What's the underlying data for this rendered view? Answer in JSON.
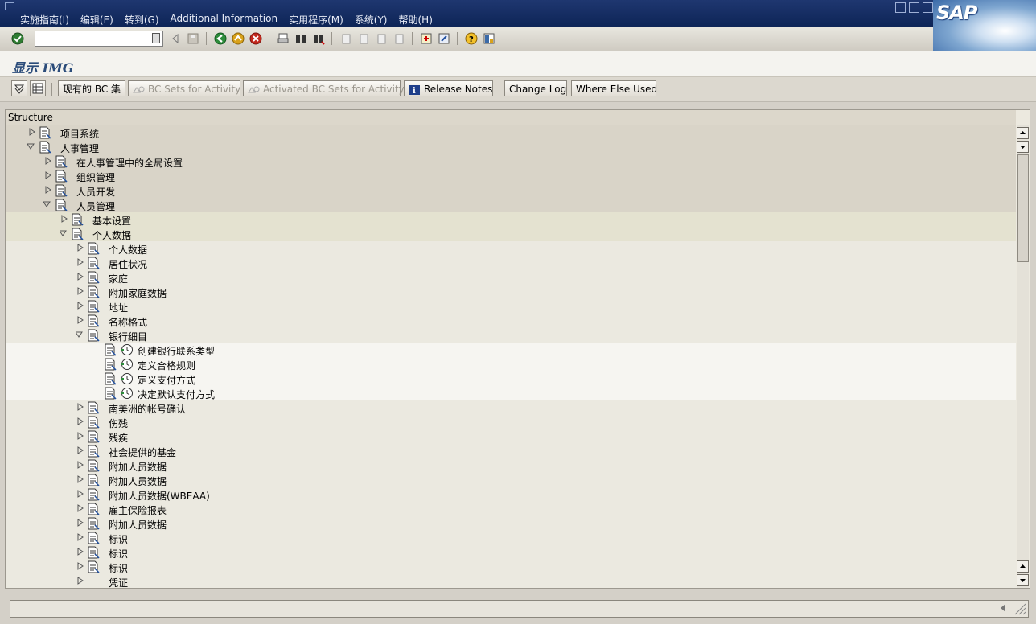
{
  "menubar": {
    "items": [
      "实施指南(I)",
      "编辑(E)",
      "转到(G)",
      "Additional Information",
      "实用程序(M)",
      "系统(Y)",
      "帮助(H)"
    ]
  },
  "logo": {
    "text": "SAP"
  },
  "toolbar": {
    "icons": [
      "enter-icon",
      "back-icon",
      "exit-icon",
      "cancel-icon",
      "print-icon",
      "find-icon",
      "find-next-icon",
      "first-page-icon",
      "prev-page-icon",
      "next-page-icon",
      "last-page-icon",
      "create-session-icon",
      "shortcut-icon",
      "help-icon",
      "layout-icon"
    ]
  },
  "title": {
    "text": "显示 IMG"
  },
  "appbar": {
    "existing_bc": "现有的 BC 集",
    "bc_sets_activity": "BC Sets for Activity",
    "activated_bc_sets": "Activated BC Sets for Activity",
    "release_notes": "Release Notes",
    "change_log": "Change Log",
    "where_else_used": "Where Else Used"
  },
  "tree": {
    "header": "Structure",
    "rows": [
      {
        "label": "项目系统",
        "level": 0,
        "expanded": false,
        "doc": true
      },
      {
        "label": "人事管理",
        "level": 0,
        "expanded": true,
        "doc": true
      },
      {
        "label": "在人事管理中的全局设置",
        "level": 1,
        "expanded": false,
        "doc": true
      },
      {
        "label": "组织管理",
        "level": 1,
        "expanded": false,
        "doc": true
      },
      {
        "label": "人员开发",
        "level": 1,
        "expanded": false,
        "doc": true
      },
      {
        "label": "人员管理",
        "level": 1,
        "expanded": true,
        "doc": true
      },
      {
        "label": "基本设置",
        "level": 2,
        "expanded": false,
        "doc": true
      },
      {
        "label": "个人数据",
        "level": 2,
        "expanded": true,
        "doc": true
      },
      {
        "label": "个人数据",
        "level": 3,
        "expanded": false,
        "doc": true
      },
      {
        "label": "居住状况",
        "level": 3,
        "expanded": false,
        "doc": true
      },
      {
        "label": "家庭",
        "level": 3,
        "expanded": false,
        "doc": true
      },
      {
        "label": "附加家庭数据",
        "level": 3,
        "expanded": false,
        "doc": true
      },
      {
        "label": "地址",
        "level": 3,
        "expanded": false,
        "doc": true
      },
      {
        "label": "名称格式",
        "level": 3,
        "expanded": false,
        "doc": true
      },
      {
        "label": "银行细目",
        "level": 3,
        "expanded": true,
        "doc": true
      },
      {
        "label": "创建银行联系类型",
        "level": 4,
        "leaf": true,
        "doc": true,
        "clock": true
      },
      {
        "label": "定义合格规则",
        "level": 4,
        "leaf": true,
        "doc": true,
        "clock": true
      },
      {
        "label": "定义支付方式",
        "level": 4,
        "leaf": true,
        "doc": true,
        "clock": true
      },
      {
        "label": "决定默认支付方式",
        "level": 4,
        "leaf": true,
        "doc": true,
        "clock": true
      },
      {
        "label": "南美洲的帐号确认",
        "level": 3,
        "expanded": false,
        "doc": true
      },
      {
        "label": "伤残",
        "level": 3,
        "expanded": false,
        "doc": true
      },
      {
        "label": "残疾",
        "level": 3,
        "expanded": false,
        "doc": true
      },
      {
        "label": "社会提供的基金",
        "level": 3,
        "expanded": false,
        "doc": true
      },
      {
        "label": "附加人员数据",
        "level": 3,
        "expanded": false,
        "doc": true
      },
      {
        "label": "附加人员数据",
        "level": 3,
        "expanded": false,
        "doc": true
      },
      {
        "label": "附加人员数据(WBEAA)",
        "level": 3,
        "expanded": false,
        "doc": true
      },
      {
        "label": "雇主保险报表",
        "level": 3,
        "expanded": false,
        "doc": true
      },
      {
        "label": "附加人员数据",
        "level": 3,
        "expanded": false,
        "doc": true
      },
      {
        "label": "标识",
        "level": 3,
        "expanded": false,
        "doc": true
      },
      {
        "label": "标识",
        "level": 3,
        "expanded": false,
        "doc": true
      },
      {
        "label": "标识",
        "level": 3,
        "expanded": false,
        "doc": true
      },
      {
        "label": "凭证",
        "level": 3,
        "expanded": false,
        "doc": false
      }
    ]
  },
  "colors": {
    "menubar": "#0d2456",
    "title": "#2b4c7a",
    "tree_bg": "#ece9df"
  }
}
